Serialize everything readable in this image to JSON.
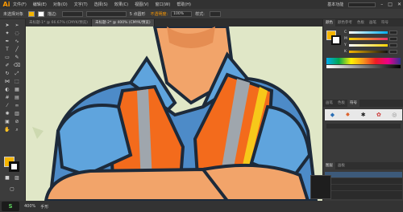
{
  "menubar": {
    "logo": "Ai",
    "items": [
      "文件(F)",
      "编辑(E)",
      "对象(O)",
      "文字(T)",
      "选择(S)",
      "效果(C)",
      "视图(V)",
      "窗口(W)",
      "帮助(H)"
    ],
    "workspace": "基本功能",
    "window_controls": [
      "–",
      "□",
      "✕"
    ]
  },
  "controlbar": {
    "selection_label": "未选择对象",
    "stroke_label": "描边:",
    "brush_label": "5 点圆形",
    "opacity_label": "不透明度:",
    "opacity_value": "100%",
    "style_label": "样式:"
  },
  "tabs": [
    {
      "label": "未标题-1* @ 66.67% (CMYK/预览)",
      "active": false
    },
    {
      "label": "未标题-2* @ 400% (CMYK/预览)",
      "active": true
    }
  ],
  "panels": {
    "top_tabs": [
      "颜色",
      "颜色参考",
      "色板",
      "画笔",
      "符号"
    ],
    "channels": [
      "C",
      "M",
      "Y",
      "K"
    ],
    "brush_tabs": [
      "画笔",
      "色板",
      "符号"
    ],
    "layer_tabs": [
      "图层",
      "画板"
    ]
  },
  "statusbar": {
    "zoom": "400%",
    "tool": "手形"
  },
  "colors": {
    "accent": "#ff9a00",
    "fill": "#f5b500",
    "canvas_bg": "#e0e7c7",
    "vest_orange": "#f36b1c",
    "shirt_blue": "#4d8bc8",
    "skin": "#f2a46a"
  }
}
